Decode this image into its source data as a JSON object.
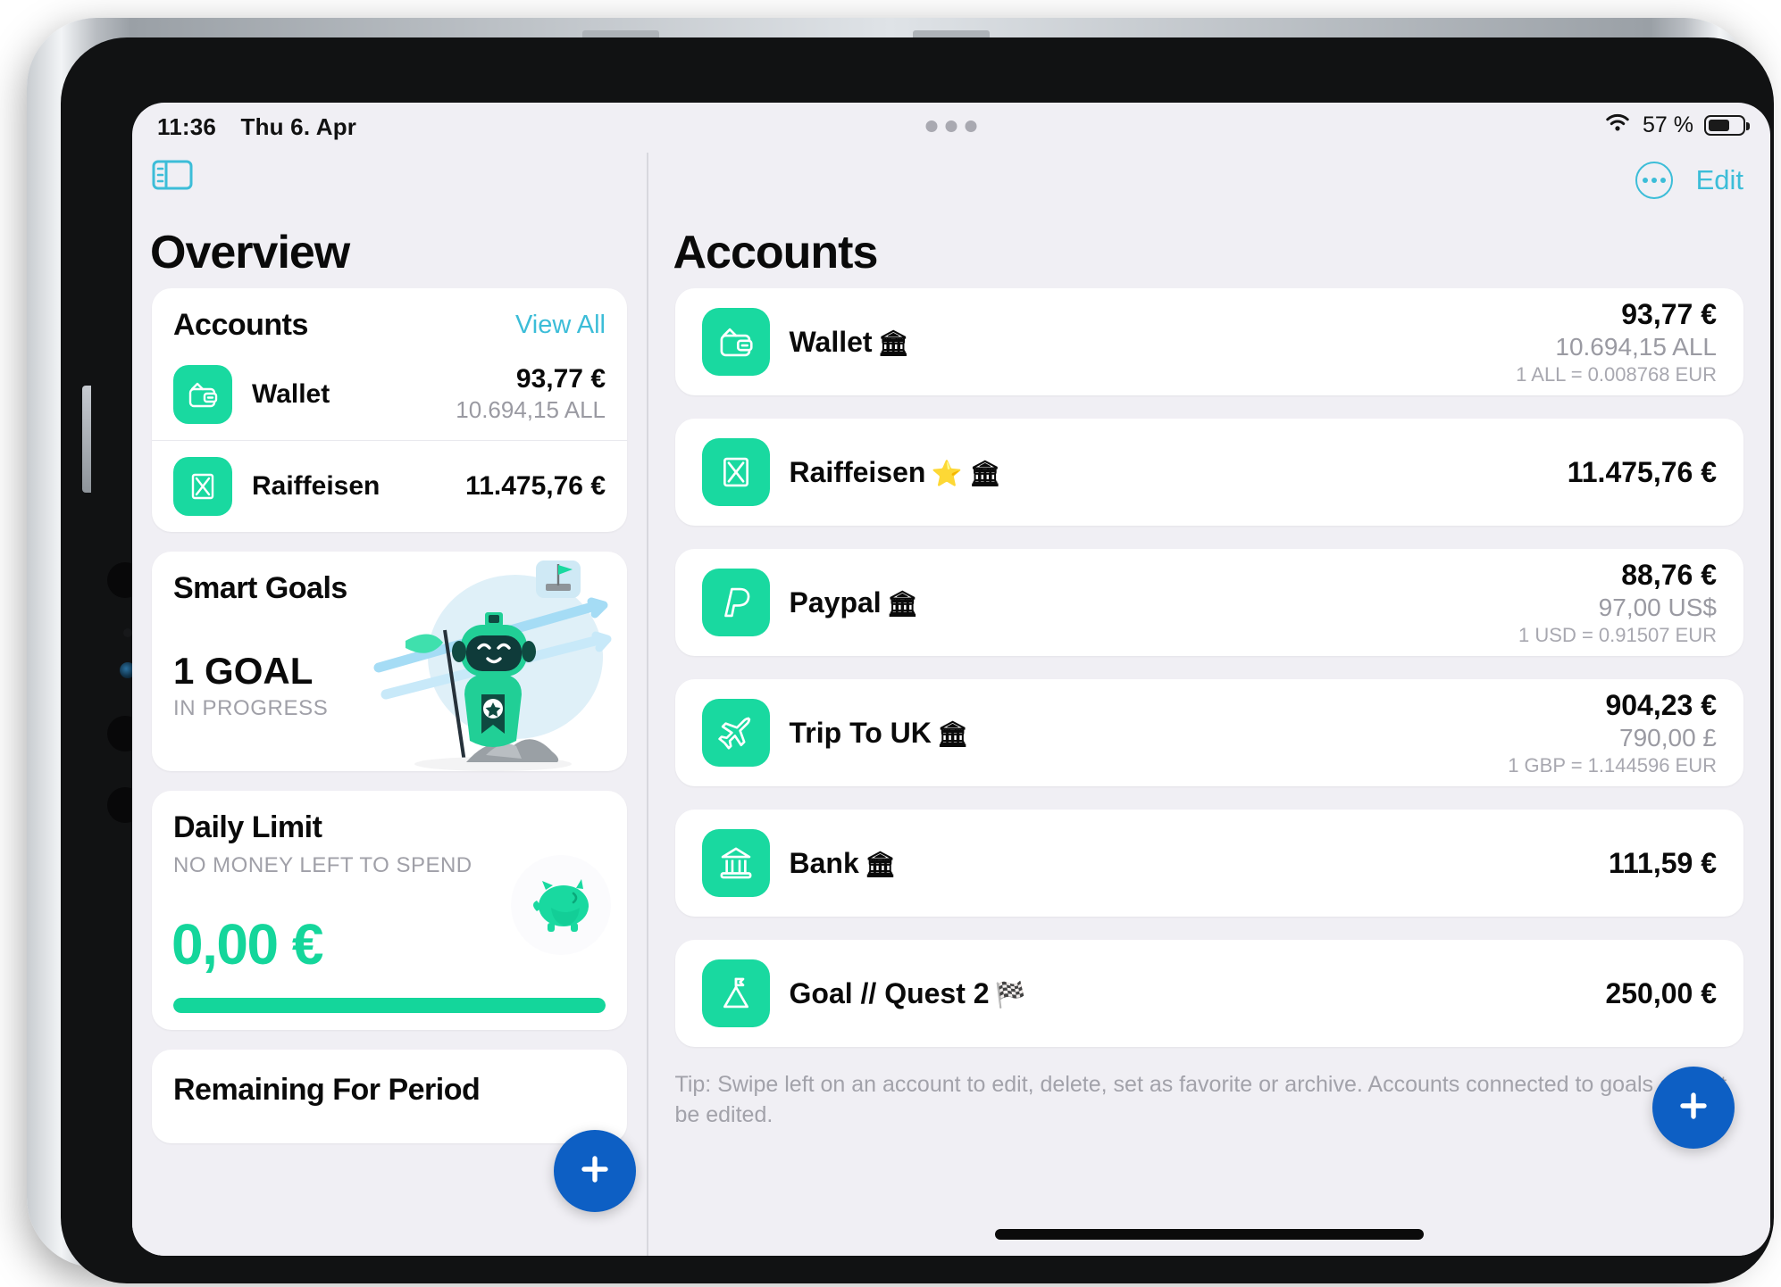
{
  "status_bar": {
    "time": "11:36",
    "date": "Thu 6. Apr",
    "battery_percent": "57 %",
    "battery_level": 57,
    "wifi_icon": "wifi-icon"
  },
  "sidebar": {
    "toggle_icon": "sidebar-toggle-icon",
    "title": "Overview",
    "accounts_card": {
      "title": "Accounts",
      "view_all": "View All",
      "rows": [
        {
          "icon": "wallet-icon",
          "name": "Wallet",
          "primary": "93,77 €",
          "secondary": "10.694,15 ALL"
        },
        {
          "icon": "raiffeisen-icon",
          "name": "Raiffeisen",
          "primary": "11.475,76 €",
          "secondary": ""
        }
      ]
    },
    "smart_goals_card": {
      "title": "Smart Goals",
      "count": "1 GOAL",
      "status": "IN PROGRESS",
      "illustration": "robot-mascot-illustration"
    },
    "daily_limit_card": {
      "title": "Daily Limit",
      "subtitle": "NO MONEY LEFT TO SPEND",
      "amount": "0,00 €",
      "progress_percent": 100,
      "icon": "piggy-bank-icon"
    },
    "remaining_card": {
      "title": "Remaining For Period"
    },
    "fab_icon": "plus-icon"
  },
  "main": {
    "title": "Accounts",
    "more_icon": "more-ellipsis-icon",
    "edit_label": "Edit",
    "fab_icon": "plus-icon",
    "tip": "Tip: Swipe left on an account to edit, delete, set as favorite or archive. Accounts connected to goals cannot be edited.",
    "accounts": [
      {
        "icon": "wallet-icon",
        "name": "Wallet",
        "badges": "🏛",
        "primary": "93,77 €",
        "secondary": "10.694,15 ALL",
        "rate": "1 ALL = 0.008768 EUR"
      },
      {
        "icon": "raiffeisen-icon",
        "name": "Raiffeisen",
        "badges": "⭐ 🏛",
        "primary": "11.475,76 €",
        "secondary": "",
        "rate": ""
      },
      {
        "icon": "paypal-icon",
        "name": "Paypal",
        "badges": "🏛",
        "primary": "88,76 €",
        "secondary": "97,00 US$",
        "rate": "1 USD = 0.91507 EUR"
      },
      {
        "icon": "airplane-icon",
        "name": "Trip To UK",
        "badges": "🏛",
        "primary": "904,23 €",
        "secondary": "790,00 £",
        "rate": "1 GBP = 1.144596 EUR"
      },
      {
        "icon": "bank-icon",
        "name": "Bank",
        "badges": "🏛",
        "primary": "111,59 €",
        "secondary": "",
        "rate": ""
      },
      {
        "icon": "mountain-flag-icon",
        "name": "Goal // Quest 2",
        "badges": "🏁",
        "primary": "250,00 €",
        "secondary": "",
        "rate": ""
      }
    ]
  },
  "colors": {
    "accent_green": "#19d99f",
    "accent_cyan": "#3cbdd8",
    "fab_blue": "#0d5fc4",
    "page_bg": "#f0eff4",
    "card_bg": "#ffffff"
  }
}
